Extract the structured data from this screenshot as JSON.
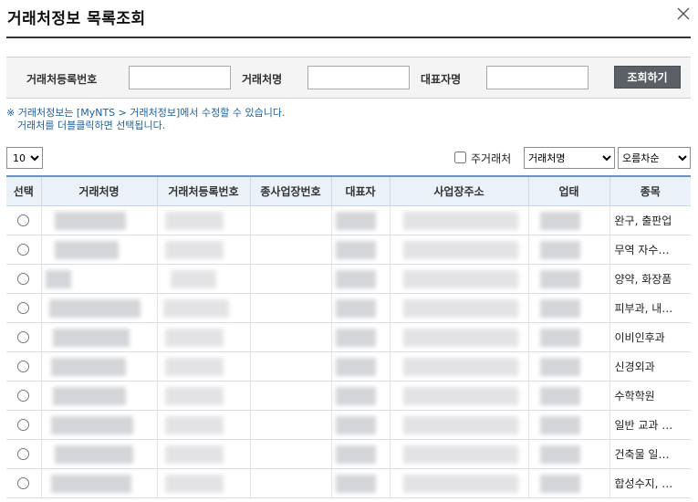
{
  "window": {
    "title": "거래처정보 목록조회",
    "close_icon": "close-icon"
  },
  "search": {
    "reg_no_label": "거래처등록번호",
    "reg_no_value": "",
    "name_label": "거래처명",
    "name_value": "",
    "rep_label": "대표자명",
    "rep_value": "",
    "button_label": "조회하기"
  },
  "notice": {
    "line1": "※ 거래처정보는 [MyNTS > 거래처정보]에서 수정할 수 있습니다.",
    "line2": "거래처를 더블클릭하면 선택됩니다."
  },
  "controls": {
    "page_size": "10",
    "favorites_label": "주거래처",
    "favorites_checked": false,
    "sort_field": "거래처명",
    "sort_order": "오름차순"
  },
  "table": {
    "columns": [
      "선택",
      "거래처명",
      "거래처등록번호",
      "종사업장번호",
      "대표자",
      "사업장주소",
      "업태",
      "종목"
    ],
    "rows": [
      {
        "item": "완구, 출판업"
      },
      {
        "item": "무역 자수…"
      },
      {
        "item": "양약, 화장품"
      },
      {
        "item": "피부과, 내…"
      },
      {
        "item": "이비인후과"
      },
      {
        "item": "신경외과"
      },
      {
        "item": "수학학원"
      },
      {
        "item": "일반 교과 …"
      },
      {
        "item": "건축물 일…"
      },
      {
        "item": "합성수지, …"
      }
    ]
  },
  "colors": {
    "header_bg": "#eaf1f9",
    "header_border": "#6d93bd",
    "button_bg": "#5b6066",
    "notice_text": "#1c5f9a"
  }
}
